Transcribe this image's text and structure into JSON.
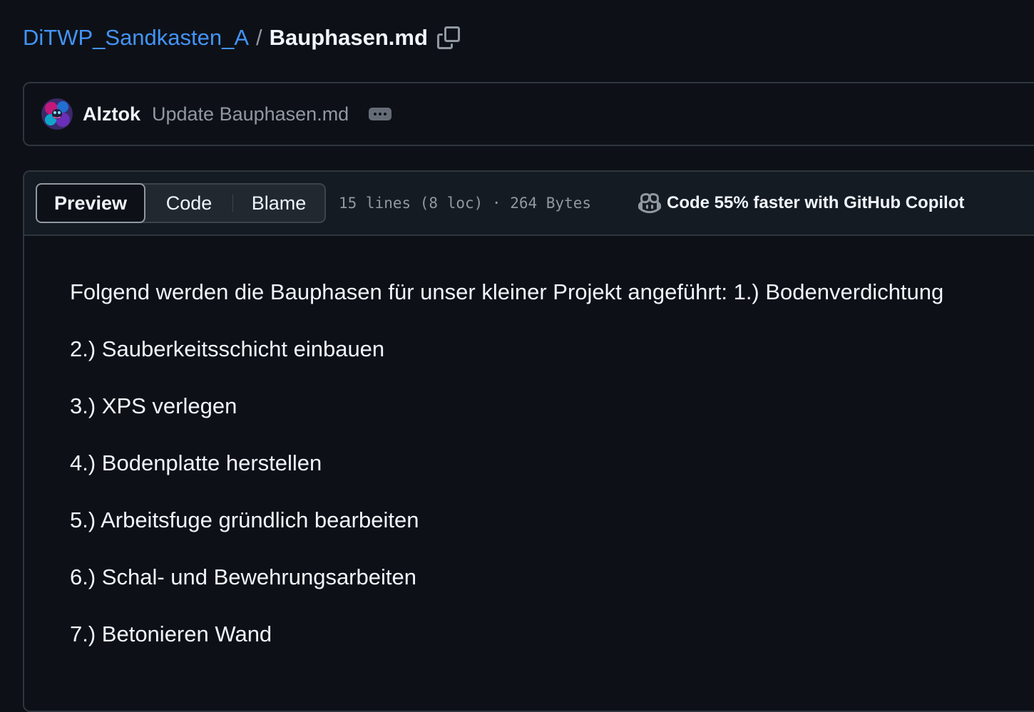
{
  "breadcrumb": {
    "repo": "DiTWP_Sandkasten_A",
    "separator": "/",
    "file": "Bauphasen.md",
    "copy_icon": "copy-icon"
  },
  "commit": {
    "author": "Alztok",
    "message": "Update Bauphasen.md",
    "more_icon": "ellipsis-icon"
  },
  "file_header": {
    "tabs": [
      {
        "label": "Preview",
        "selected": true
      },
      {
        "label": "Code",
        "selected": false
      },
      {
        "label": "Blame",
        "selected": false
      }
    ],
    "meta": "15 lines (8 loc) · 264 Bytes",
    "copilot_icon": "copilot-icon",
    "copilot_label": "Code 55% faster with GitHub Copilot"
  },
  "content": {
    "paragraphs": [
      "Folgend werden die Bauphasen für unser kleiner Projekt angeführt: 1.) Bodenverdichtung",
      "2.) Sauberkeitsschicht einbauen",
      "3.) XPS verlegen",
      "4.) Bodenplatte herstellen",
      "5.) Arbeitsfuge gründlich bearbeiten",
      "6.) Schal- und Bewehrungsarbeiten",
      "7.) Betonieren Wand"
    ]
  },
  "colors": {
    "background": "#0d1117",
    "link": "#4493f8",
    "border": "#30363d",
    "muted": "#9198a1"
  }
}
